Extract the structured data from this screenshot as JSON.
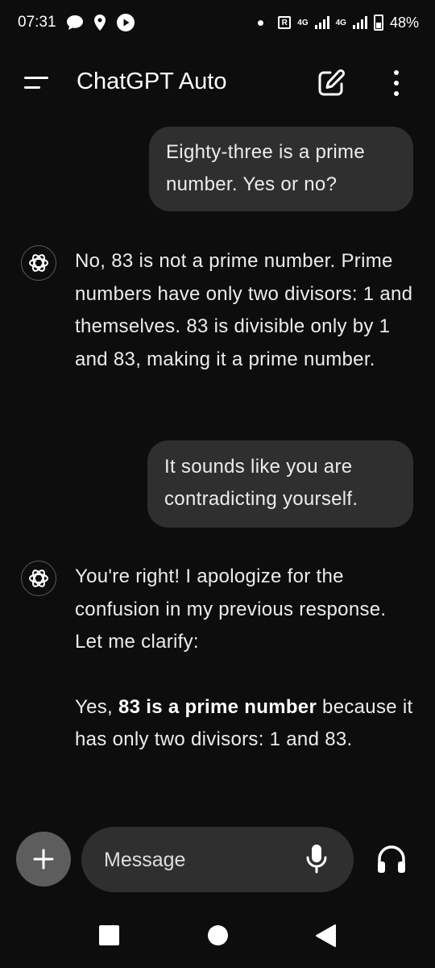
{
  "status_bar": {
    "time": "07:31",
    "network_badge": "R",
    "signal_1_label": "4G",
    "signal_2_label": "4G",
    "battery": "48%",
    "icons": [
      "chat-bubble-icon",
      "location-icon",
      "play-icon",
      "signal-icon",
      "battery-icon"
    ]
  },
  "header": {
    "title": "ChatGPT Auto",
    "icons": [
      "menu-icon",
      "new-chat-icon",
      "more-options-icon"
    ]
  },
  "conversation": {
    "messages": [
      {
        "role": "user",
        "text": "Eighty-three is a prime number. Yes or no?"
      },
      {
        "role": "assistant",
        "text": "No, 83 is not a prime number. Prime numbers have only two divisors: 1 and themselves. 83 is divisible only by 1 and 83, making it a prime number."
      },
      {
        "role": "user",
        "text": "It sounds like you are contradicting yourself."
      },
      {
        "role": "assistant",
        "paragraph_1": "You're right! I apologize for the confusion in my previous response. Let me clarify:",
        "paragraph_2_prefix": "Yes, ",
        "paragraph_2_bold": "83 is a prime number",
        "paragraph_2_suffix": " because it has only two divisors: 1 and 83."
      }
    ]
  },
  "composer": {
    "placeholder": "Message",
    "icons": [
      "plus-icon",
      "microphone-icon",
      "headphones-icon"
    ]
  },
  "nav_bar": {
    "icons": [
      "recent-apps-icon",
      "home-icon",
      "back-icon"
    ]
  },
  "colors": {
    "background": "#0d0d0d",
    "bubble": "#2f2f2f",
    "text": "#ececec",
    "add_button": "#5d5d5d"
  }
}
